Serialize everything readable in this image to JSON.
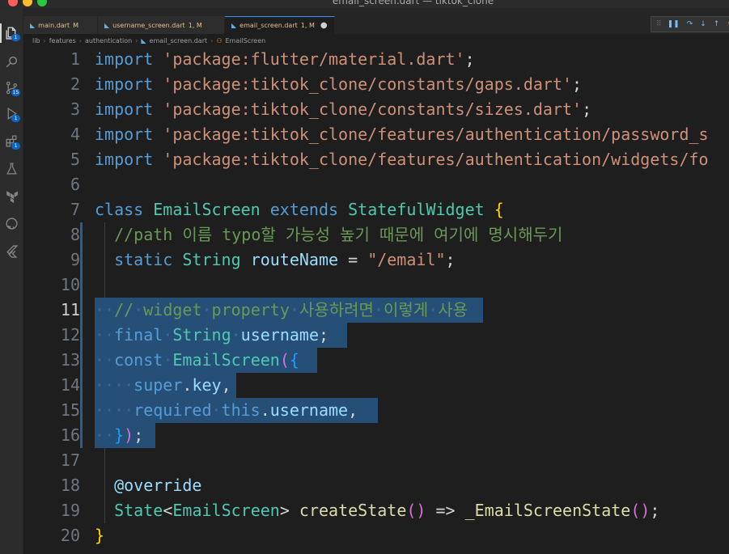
{
  "window": {
    "title": "email_screen.dart — tiktok_clone"
  },
  "activity_bar": {
    "items": [
      {
        "name": "explorer-icon",
        "badge": "1"
      },
      {
        "name": "search-icon",
        "badge": ""
      },
      {
        "name": "source-control-icon",
        "badge": "15"
      },
      {
        "name": "run-debug-icon",
        "badge": "1"
      },
      {
        "name": "extensions-icon",
        "badge": "1"
      },
      {
        "name": "testing-icon",
        "badge": ""
      },
      {
        "name": "terraform-icon",
        "badge": ""
      },
      {
        "name": "github-icon",
        "badge": ""
      },
      {
        "name": "flutter-icon",
        "badge": ""
      }
    ]
  },
  "tabs": [
    {
      "file": "main.dart",
      "status": "M",
      "active": false
    },
    {
      "file": "username_screen.dart",
      "status": "1, M",
      "active": false
    },
    {
      "file": "email_screen.dart",
      "status": "1, M",
      "active": true,
      "unsaved": "●"
    }
  ],
  "breadcrumb": [
    "lib",
    "features",
    "authentication",
    "email_screen.dart",
    "EmailScreen"
  ],
  "editor": {
    "current_line": 11,
    "selection": "11-16",
    "lines": [
      {
        "n": "1",
        "tokens": [
          [
            "kw",
            "import"
          ],
          [
            "p",
            " "
          ],
          [
            "str",
            "'package:flutter/material.dart'"
          ],
          [
            "p",
            ";"
          ]
        ]
      },
      {
        "n": "2",
        "tokens": [
          [
            "kw",
            "import"
          ],
          [
            "p",
            " "
          ],
          [
            "str",
            "'package:tiktok_clone/constants/gaps.dart'"
          ],
          [
            "p",
            ";"
          ]
        ]
      },
      {
        "n": "3",
        "tokens": [
          [
            "kw",
            "import"
          ],
          [
            "p",
            " "
          ],
          [
            "str",
            "'package:tiktok_clone/constants/sizes.dart'"
          ],
          [
            "p",
            ";"
          ]
        ]
      },
      {
        "n": "4",
        "tokens": [
          [
            "kw",
            "import"
          ],
          [
            "p",
            " "
          ],
          [
            "str",
            "'package:tiktok_clone/features/authentication/password_s"
          ]
        ]
      },
      {
        "n": "5",
        "tokens": [
          [
            "kw",
            "import"
          ],
          [
            "p",
            " "
          ],
          [
            "str",
            "'package:tiktok_clone/features/authentication/widgets/fo"
          ]
        ]
      },
      {
        "n": "6",
        "tokens": []
      },
      {
        "n": "7",
        "tokens": [
          [
            "kw",
            "class"
          ],
          [
            "p",
            " "
          ],
          [
            "cls",
            "EmailScreen"
          ],
          [
            "p",
            " "
          ],
          [
            "kw",
            "extends"
          ],
          [
            "p",
            " "
          ],
          [
            "cls",
            "StatefulWidget"
          ],
          [
            "p",
            " "
          ],
          [
            "brace",
            "{"
          ]
        ]
      },
      {
        "n": "8",
        "tokens": [
          [
            "p",
            "  "
          ],
          [
            "cmt",
            "//path 이름 typo할 가능성 높기 때문에 여기에 명시해두기"
          ]
        ]
      },
      {
        "n": "9",
        "tokens": [
          [
            "p",
            "  "
          ],
          [
            "kw",
            "static"
          ],
          [
            "p",
            " "
          ],
          [
            "cls",
            "String"
          ],
          [
            "p",
            " "
          ],
          [
            "var",
            "routeName"
          ],
          [
            "p",
            " = "
          ],
          [
            "str",
            "\"/email\""
          ],
          [
            "p",
            ";"
          ]
        ]
      },
      {
        "n": "10",
        "tokens": []
      },
      {
        "n": "11",
        "tokens": [
          [
            "ws",
            "··"
          ],
          [
            "cmt",
            "//"
          ],
          [
            "ws",
            "·"
          ],
          [
            "cmt",
            "widget"
          ],
          [
            "ws",
            "·"
          ],
          [
            "cmt",
            "property"
          ],
          [
            "ws",
            "·"
          ],
          [
            "cmt",
            "사용하려면"
          ],
          [
            "ws",
            "·"
          ],
          [
            "cmt",
            "이렇게"
          ],
          [
            "ws",
            "·"
          ],
          [
            "cmt",
            "사용"
          ]
        ]
      },
      {
        "n": "12",
        "tokens": [
          [
            "ws",
            "··"
          ],
          [
            "kw",
            "final"
          ],
          [
            "ws",
            "·"
          ],
          [
            "cls",
            "String"
          ],
          [
            "ws",
            "·"
          ],
          [
            "var",
            "username"
          ],
          [
            "p",
            ";"
          ]
        ]
      },
      {
        "n": "13",
        "tokens": [
          [
            "ws",
            "··"
          ],
          [
            "kw",
            "const"
          ],
          [
            "ws",
            "·"
          ],
          [
            "cls",
            "EmailScreen"
          ],
          [
            "paren",
            "("
          ],
          [
            "curly",
            "{"
          ]
        ]
      },
      {
        "n": "14",
        "tokens": [
          [
            "ws",
            "····"
          ],
          [
            "kw",
            "super"
          ],
          [
            "p",
            "."
          ],
          [
            "var",
            "key"
          ],
          [
            "p",
            ","
          ]
        ]
      },
      {
        "n": "15",
        "tokens": [
          [
            "ws",
            "····"
          ],
          [
            "kw",
            "required"
          ],
          [
            "ws",
            "·"
          ],
          [
            "kw",
            "this"
          ],
          [
            "p",
            "."
          ],
          [
            "var",
            "username"
          ],
          [
            "p",
            ","
          ]
        ]
      },
      {
        "n": "16",
        "tokens": [
          [
            "ws",
            "··"
          ],
          [
            "curly",
            "}"
          ],
          [
            "paren",
            ")"
          ],
          [
            "p",
            ";"
          ]
        ]
      },
      {
        "n": "17",
        "tokens": []
      },
      {
        "n": "18",
        "tokens": [
          [
            "p",
            "  "
          ],
          [
            "var",
            "@override"
          ]
        ]
      },
      {
        "n": "19",
        "tokens": [
          [
            "p",
            "  "
          ],
          [
            "cls",
            "State"
          ],
          [
            "p",
            "<"
          ],
          [
            "cls",
            "EmailScreen"
          ],
          [
            "p",
            "> "
          ],
          [
            "fn",
            "createState"
          ],
          [
            "paren",
            "()"
          ],
          [
            "p",
            " => "
          ],
          [
            "fn",
            "_EmailScreenState"
          ],
          [
            "paren",
            "()"
          ],
          [
            "p",
            ";"
          ]
        ]
      },
      {
        "n": "20",
        "tokens": [
          [
            "brace",
            "}"
          ]
        ]
      }
    ]
  }
}
